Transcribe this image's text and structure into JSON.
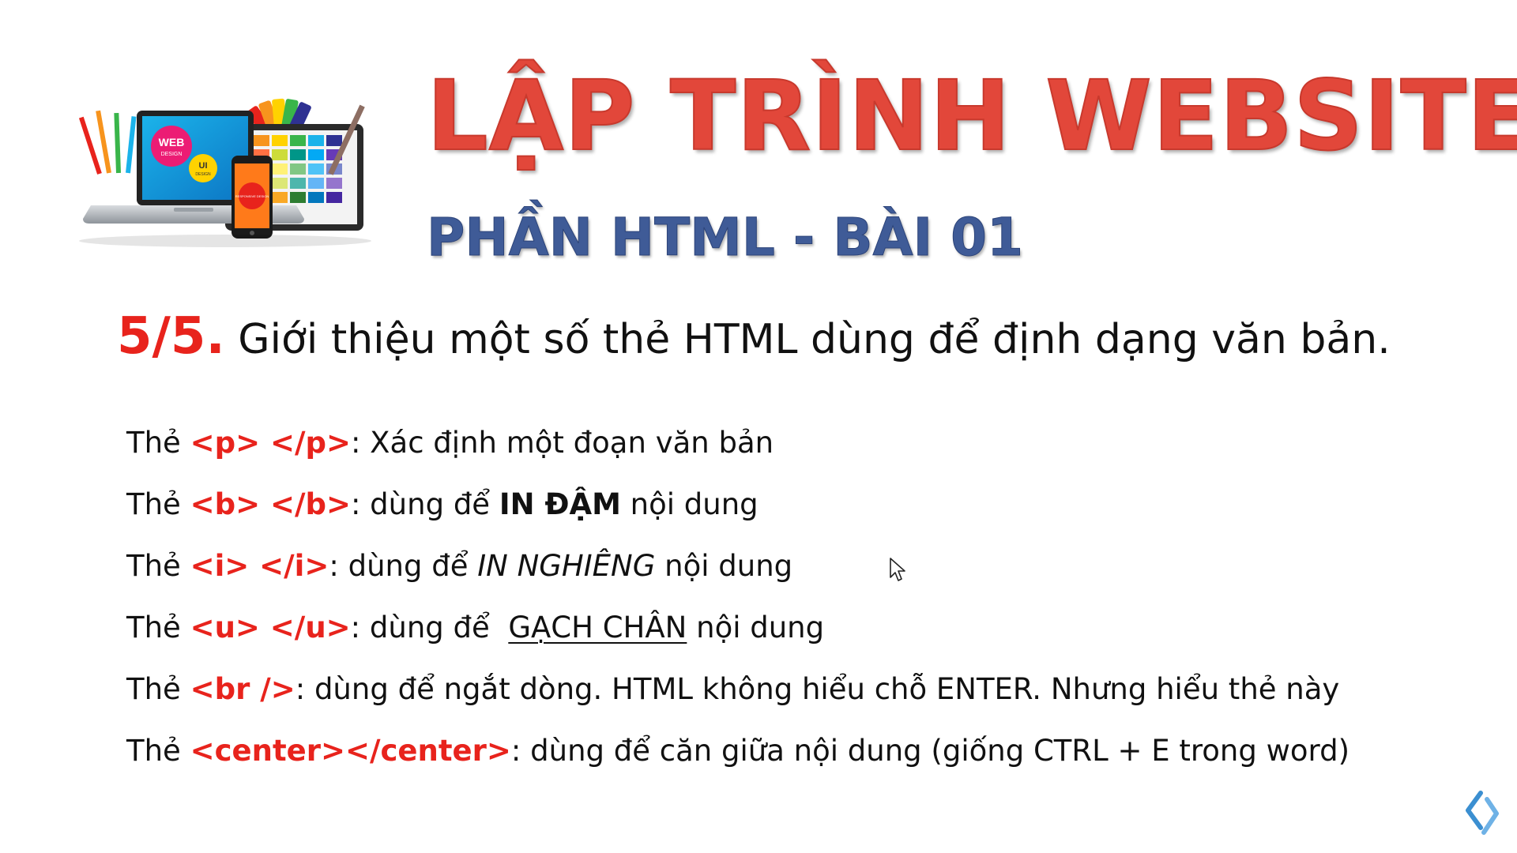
{
  "header": {
    "title": "LẬP TRÌNH WEBSITE",
    "subtitle": "PHẦN HTML - BÀI 01",
    "illustration": {
      "laptop_badge_main": "WEB",
      "laptop_badge_main_sub": "DESIGN",
      "laptop_badge_ui": "UI",
      "laptop_badge_ui_sub": "DESIGN",
      "phone_badge": "RESPONSIVE DESIGN"
    }
  },
  "section": {
    "number": "5/5.",
    "title": "Giới thiệu một số thẻ HTML dùng để định dạng văn bản."
  },
  "tags": [
    {
      "prefix": "Thẻ ",
      "tag": "<p> </p>",
      "text_before": ": Xác định một đoạn văn bản",
      "emphasis": "",
      "text_after": ""
    },
    {
      "prefix": "Thẻ ",
      "tag": "<b> </b>",
      "text_before": ": dùng để ",
      "emphasis": "IN ĐẬM",
      "text_after": " nội dung"
    },
    {
      "prefix": "Thẻ ",
      "tag": "<i> </i>",
      "text_before": ": dùng để ",
      "emphasis": "IN NGHIÊNG",
      "text_after": " nội dung"
    },
    {
      "prefix": "Thẻ ",
      "tag": "<u> </u>",
      "text_before": ": dùng để  ",
      "emphasis": "GẠCH CHÂN",
      "text_after": " nội dung"
    },
    {
      "prefix": "Thẻ ",
      "tag": "<br />",
      "text_before": ": dùng để ngắt dòng. HTML không hiểu chỗ ENTER. Nhưng hiểu thẻ này",
      "emphasis": "",
      "text_after": ""
    },
    {
      "prefix": "Thẻ ",
      "tag": "<center></center>",
      "text_before": ": dùng để căn giữa nội dung (giống CTRL + E trong word)",
      "emphasis": "",
      "text_after": ""
    }
  ],
  "colors": {
    "title_red": "#e2473a",
    "subtitle_blue": "#3f5b97",
    "tag_red": "#e8231c",
    "body_text": "#111111"
  },
  "icons": {
    "cursor": "mouse-pointer-icon",
    "logo": "chevron-logo-icon"
  }
}
